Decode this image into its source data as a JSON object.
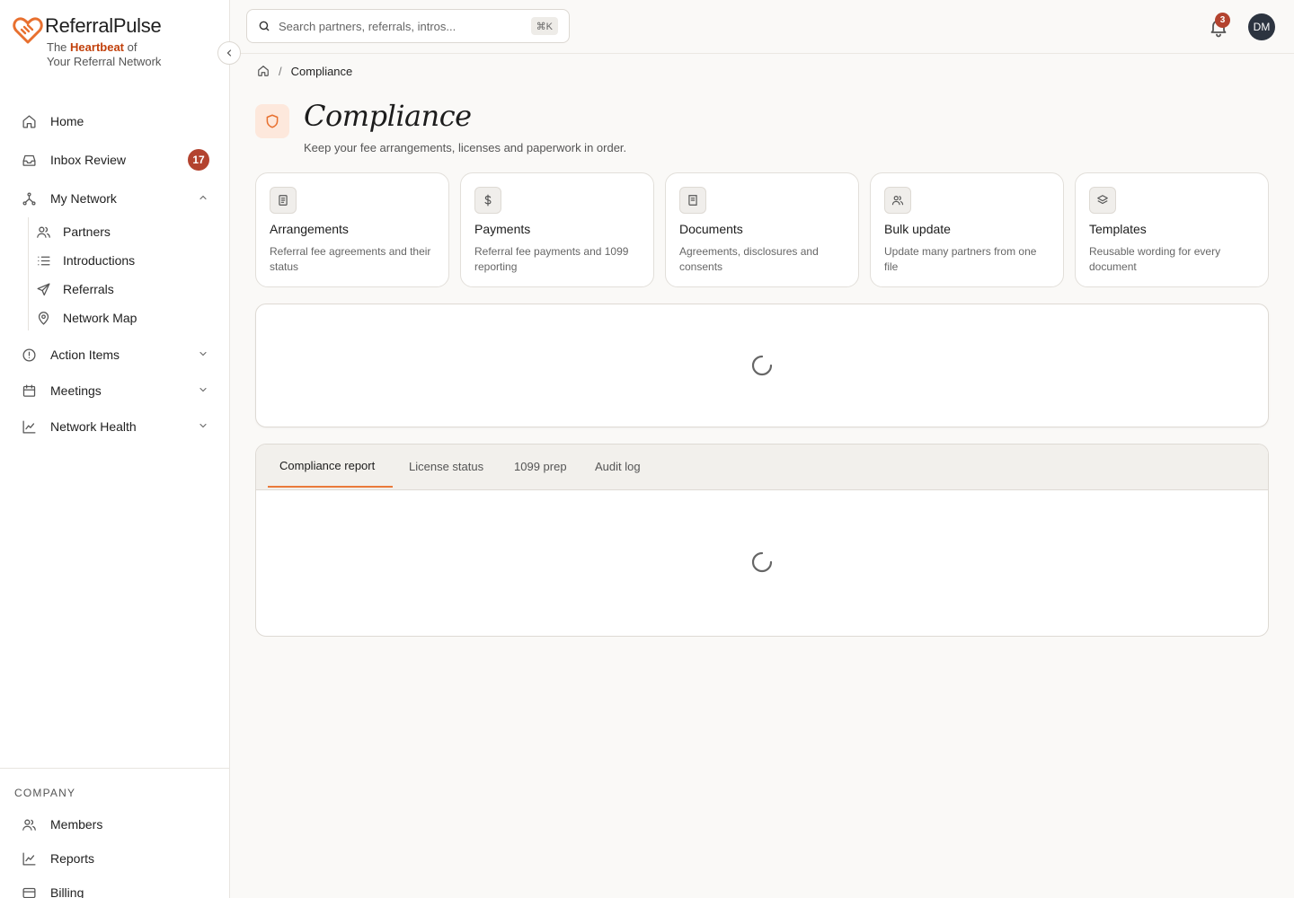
{
  "brand": {
    "name": "ReferralPulse",
    "tag_prefix": "The",
    "tag_highlight": "Heartbeat",
    "tag_suffix": "of",
    "tag_line2": "Your Referral Network",
    "accent_color": "#c2410c"
  },
  "nav": {
    "home": "Home",
    "inbox": "Inbox Review",
    "inbox_count": "17",
    "my_network": "My Network",
    "sub": {
      "partners": "Partners",
      "introductions": "Introductions",
      "referrals": "Referrals",
      "network_map": "Network Map"
    },
    "action_items": "Action Items",
    "meetings": "Meetings",
    "network_health": "Network Health"
  },
  "company": {
    "label": "COMPANY",
    "members": "Members",
    "reports": "Reports",
    "billing": "Billing"
  },
  "topbar": {
    "search_placeholder": "Search partners, referrals, intros...",
    "shortcut": "⌘K",
    "notification_count": "3",
    "avatar_initials": "DM"
  },
  "breadcrumb": {
    "current": "Compliance"
  },
  "page": {
    "title": "Compliance",
    "subtitle": "Keep your fee arrangements, licenses and paperwork in order."
  },
  "cards": [
    {
      "title": "Arrangements",
      "desc": "Referral fee agreements and their status",
      "icon": "document-list-icon"
    },
    {
      "title": "Payments",
      "desc": "Referral fee payments and 1099 reporting",
      "icon": "dollar-icon"
    },
    {
      "title": "Documents",
      "desc": "Agreements, disclosures and consents",
      "icon": "book-icon"
    },
    {
      "title": "Bulk update",
      "desc": "Update many partners from one file",
      "icon": "users-icon"
    },
    {
      "title": "Templates",
      "desc": "Reusable wording for every document",
      "icon": "layers-icon"
    }
  ],
  "tabs": {
    "active": "Compliance report",
    "items": [
      "Compliance report",
      "License status",
      "1099 prep",
      "Audit log"
    ]
  },
  "colors": {
    "accent": "#ea7a3a",
    "badge": "#b3432f",
    "avatar": "#2c3440"
  }
}
